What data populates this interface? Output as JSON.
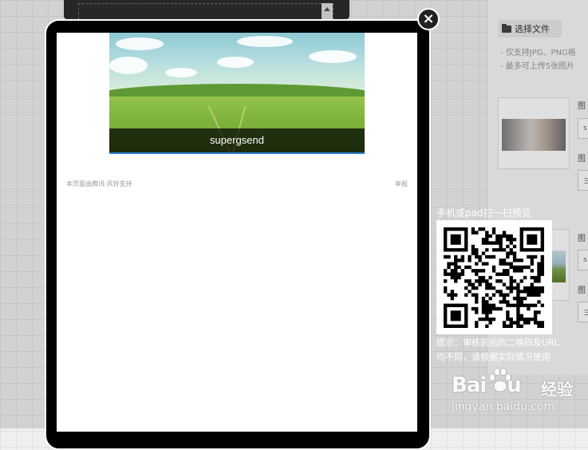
{
  "editor": {
    "choose_file_label": "选择文件",
    "hint_formats": "- 仅支持JPG、PNG格",
    "hint_max": "- 最多可上传5张图片",
    "field_label_1": "图",
    "field_label_2": "图",
    "field_label_3": "图",
    "field_label_4": "图",
    "field_value_1": "s",
    "field_value_2": "ヨ",
    "field_value_3": "s",
    "field_value_4": "ヨ"
  },
  "preview": {
    "banner_caption": "supergsend",
    "footer_left": "本页面由腾讯·风铃支持",
    "footer_right": "举报",
    "close_symbol": "×"
  },
  "qr": {
    "title": "手机或pad扫一扫预览",
    "tip": "提示：审核前后的二维码及URL均不同，请根据实际情况使用"
  },
  "watermark": {
    "brand_en": "Bai",
    "brand_en2": "u",
    "brand_cn": "经验",
    "url": "jingyan.baidu.com"
  },
  "colors": {
    "caption_bar": "#000000",
    "banner_underline": "#2c7fd4",
    "device_frame": "#000000"
  }
}
